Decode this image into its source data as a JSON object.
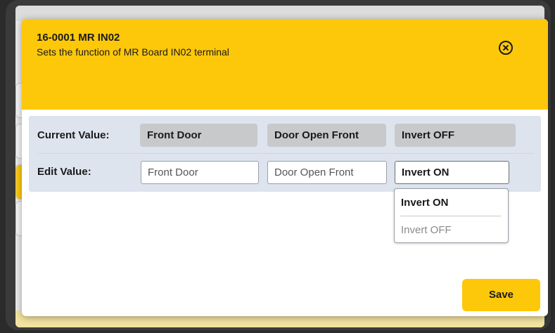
{
  "dialog": {
    "title": "16-0001 MR IN02",
    "subtitle": "Sets the function of MR Board IN02 terminal",
    "close_icon": "close-circle-icon"
  },
  "current": {
    "label": "Current Value:",
    "values": [
      "Front Door",
      "Door Open Front",
      "Invert OFF"
    ]
  },
  "edit": {
    "label": "Edit Value:",
    "inputs": [
      "Front Door",
      "Door Open Front"
    ],
    "select_value": "Invert ON"
  },
  "dropdown": {
    "options": [
      "Invert ON",
      "Invert OFF"
    ]
  },
  "save_label": "Save",
  "colors": {
    "accent": "#fdc80a",
    "panel": "#dde4ee",
    "current_value_bg": "#c8c9cb"
  }
}
